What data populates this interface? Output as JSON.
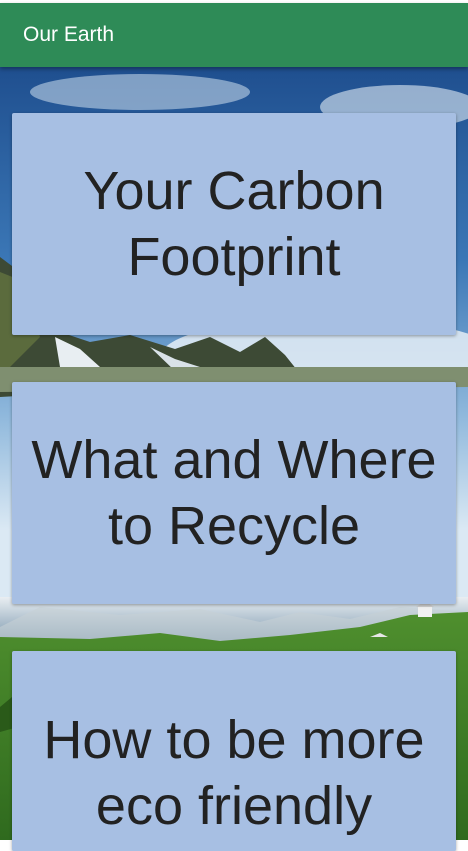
{
  "app_bar": {
    "title": "Our Earth",
    "color": "#2e8b57"
  },
  "background": {
    "icon": "landscape-photo"
  },
  "cards": [
    {
      "label": "Your Carbon Footprint"
    },
    {
      "label": "What and Where to Recycle"
    },
    {
      "label": "How to be more eco friendly"
    }
  ],
  "card_color": "#a7bfe3"
}
